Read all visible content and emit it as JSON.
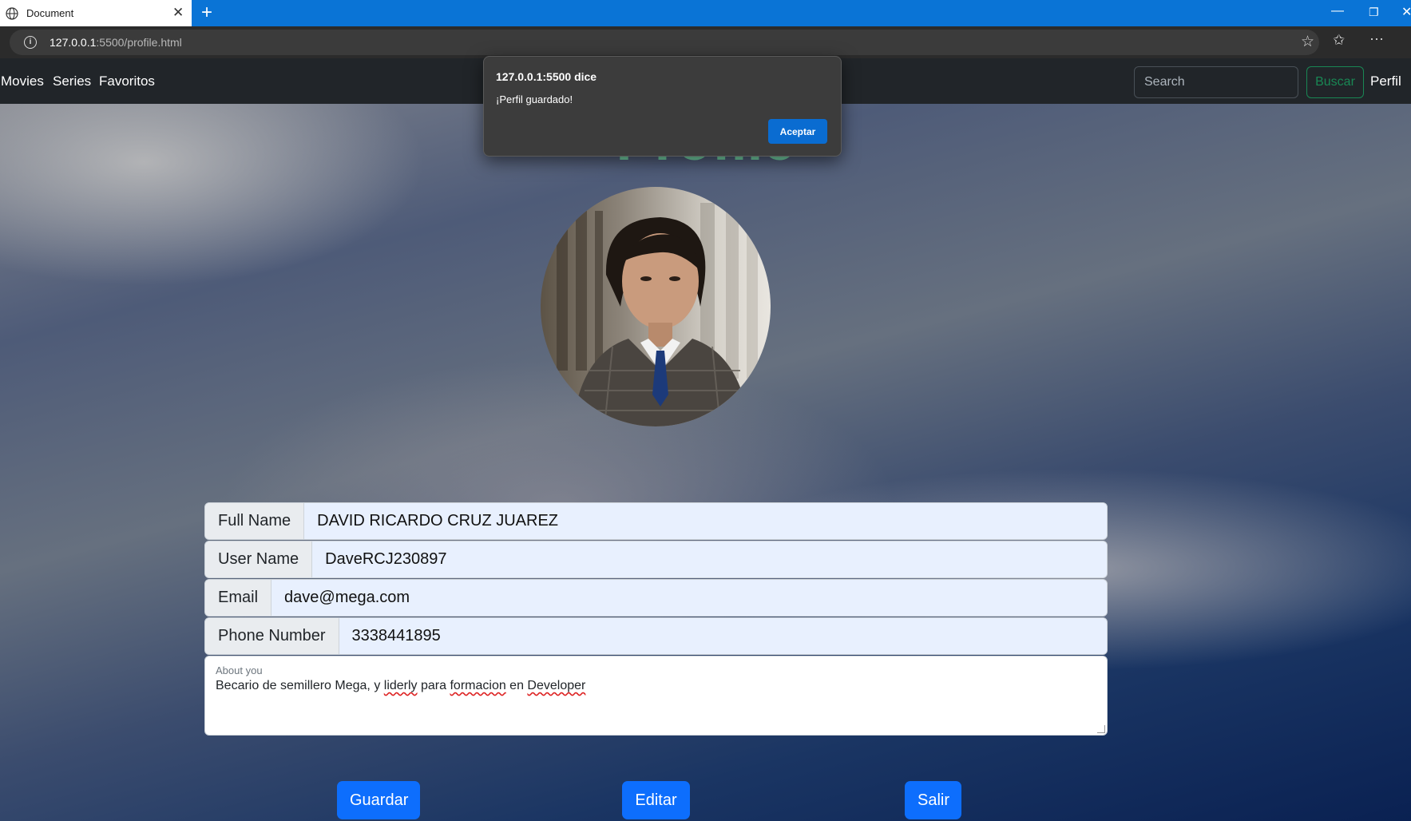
{
  "browser": {
    "tab_title": "Document",
    "url_host": "127.0.0.1",
    "url_rest": ":5500/profile.html",
    "icons": [
      "globe-icon",
      "close-icon",
      "plus-icon",
      "info-icon",
      "star-icon",
      "favorites-icon",
      "more-icon",
      "minimize-icon",
      "restore-icon",
      "window-close-icon"
    ]
  },
  "nav": {
    "links": [
      "Movies",
      "Series",
      "Favoritos"
    ],
    "search_placeholder": "Search",
    "search_button": "Buscar",
    "profile_link": "Perfil"
  },
  "page": {
    "title": "Profile"
  },
  "form": {
    "full_name": {
      "label": "Full Name",
      "value": "DAVID RICARDO CRUZ JUAREZ"
    },
    "user_name": {
      "label": "User Name",
      "value": "DaveRCJ230897"
    },
    "email": {
      "label": "Email",
      "value": "dave@mega.com"
    },
    "phone": {
      "label": "Phone Number",
      "value": "3338441895"
    },
    "about": {
      "label": "About you",
      "text_parts": [
        "Becario de semillero Mega, y ",
        "liderly",
        " para ",
        "formacion",
        " en ",
        "Developer"
      ]
    }
  },
  "buttons": {
    "save": "Guardar",
    "edit": "Editar",
    "exit": "Salir"
  },
  "dialog": {
    "title": "127.0.0.1:5500 dice",
    "message": "¡Perfil guardado!",
    "ok": "Aceptar"
  },
  "colors": {
    "browser_accent": "#0a74d6",
    "navbar": "#212529",
    "title_green": "#74d3a6",
    "primary": "#0d6efd",
    "buscar_green": "#198754"
  }
}
